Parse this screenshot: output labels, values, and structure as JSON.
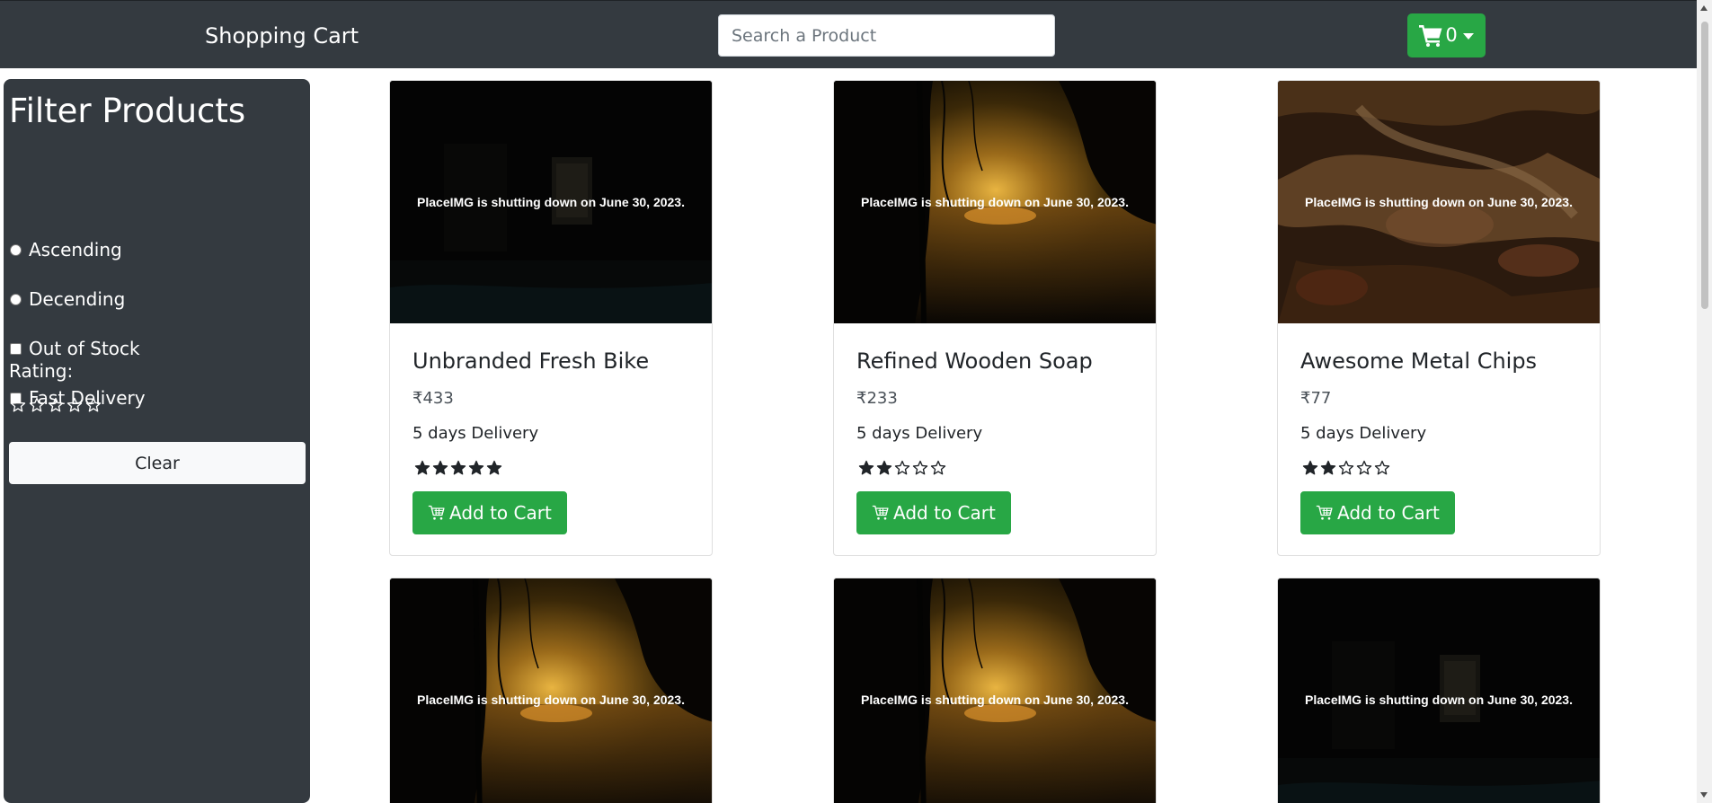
{
  "navbar": {
    "brand": "Shopping Cart",
    "search_placeholder": "Search a Product",
    "cart_count": "0",
    "bg_color": "#343a40",
    "accent_color": "#28a745"
  },
  "sidebar": {
    "title": "Filter Products",
    "options": [
      {
        "label": "Ascending",
        "type": "radio",
        "checked": false
      },
      {
        "label": "Decending",
        "type": "radio",
        "checked": false
      },
      {
        "label": "Out of Stock",
        "type": "checkbox",
        "checked": false
      },
      {
        "label": "Fast Delivery",
        "type": "checkbox",
        "checked": false
      }
    ],
    "rating_label": "Rating:",
    "rating_value": 0,
    "rating_max": 5,
    "clear_label": "Clear"
  },
  "products": [
    {
      "name": "Unbranded Fresh Bike",
      "price": "₹433",
      "delivery": "5 days Delivery",
      "rating": 5,
      "image_text": "PlaceIMG is shutting down on June 30, 2023.",
      "button": "Add to Cart",
      "image": "dark-room"
    },
    {
      "name": "Refined Wooden Soap",
      "price": "₹233",
      "delivery": "5 days Delivery",
      "rating": 2,
      "image_text": "PlaceIMG is shutting down on June 30, 2023.",
      "button": "Add to Cart",
      "image": "sunset-lake"
    },
    {
      "name": "Awesome Metal Chips",
      "price": "₹77",
      "delivery": "5 days Delivery",
      "rating": 2,
      "image_text": "PlaceIMG is shutting down on June 30, 2023.",
      "button": "Add to Cart",
      "image": "forest-floor"
    },
    {
      "image_text": "PlaceIMG is shutting down on June 30, 2023.",
      "image": "sunset-lake"
    },
    {
      "image_text": "PlaceIMG is shutting down on June 30, 2023.",
      "image": "sunset-lake"
    },
    {
      "image_text": "PlaceIMG is shutting down on June 30, 2023.",
      "image": "dark-room"
    }
  ],
  "icons": {
    "cart": "shopping-cart-icon",
    "star": "star-icon",
    "add_to_cart": "cart-plus-icon"
  }
}
